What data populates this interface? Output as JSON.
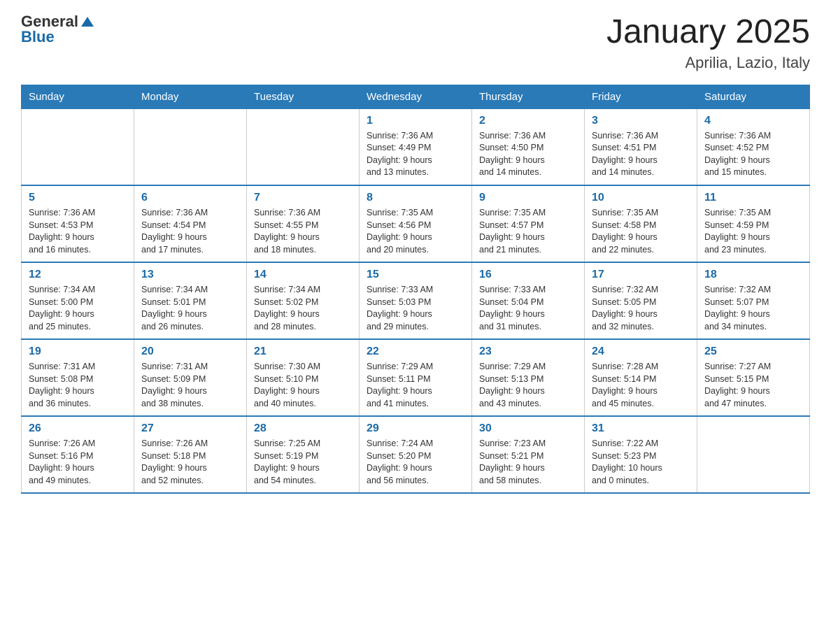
{
  "logo": {
    "text_general": "General",
    "text_blue": "Blue",
    "arrow": "▲"
  },
  "title": "January 2025",
  "subtitle": "Aprilia, Lazio, Italy",
  "weekdays": [
    "Sunday",
    "Monday",
    "Tuesday",
    "Wednesday",
    "Thursday",
    "Friday",
    "Saturday"
  ],
  "weeks": [
    [
      {
        "day": "",
        "info": ""
      },
      {
        "day": "",
        "info": ""
      },
      {
        "day": "",
        "info": ""
      },
      {
        "day": "1",
        "info": "Sunrise: 7:36 AM\nSunset: 4:49 PM\nDaylight: 9 hours\nand 13 minutes."
      },
      {
        "day": "2",
        "info": "Sunrise: 7:36 AM\nSunset: 4:50 PM\nDaylight: 9 hours\nand 14 minutes."
      },
      {
        "day": "3",
        "info": "Sunrise: 7:36 AM\nSunset: 4:51 PM\nDaylight: 9 hours\nand 14 minutes."
      },
      {
        "day": "4",
        "info": "Sunrise: 7:36 AM\nSunset: 4:52 PM\nDaylight: 9 hours\nand 15 minutes."
      }
    ],
    [
      {
        "day": "5",
        "info": "Sunrise: 7:36 AM\nSunset: 4:53 PM\nDaylight: 9 hours\nand 16 minutes."
      },
      {
        "day": "6",
        "info": "Sunrise: 7:36 AM\nSunset: 4:54 PM\nDaylight: 9 hours\nand 17 minutes."
      },
      {
        "day": "7",
        "info": "Sunrise: 7:36 AM\nSunset: 4:55 PM\nDaylight: 9 hours\nand 18 minutes."
      },
      {
        "day": "8",
        "info": "Sunrise: 7:35 AM\nSunset: 4:56 PM\nDaylight: 9 hours\nand 20 minutes."
      },
      {
        "day": "9",
        "info": "Sunrise: 7:35 AM\nSunset: 4:57 PM\nDaylight: 9 hours\nand 21 minutes."
      },
      {
        "day": "10",
        "info": "Sunrise: 7:35 AM\nSunset: 4:58 PM\nDaylight: 9 hours\nand 22 minutes."
      },
      {
        "day": "11",
        "info": "Sunrise: 7:35 AM\nSunset: 4:59 PM\nDaylight: 9 hours\nand 23 minutes."
      }
    ],
    [
      {
        "day": "12",
        "info": "Sunrise: 7:34 AM\nSunset: 5:00 PM\nDaylight: 9 hours\nand 25 minutes."
      },
      {
        "day": "13",
        "info": "Sunrise: 7:34 AM\nSunset: 5:01 PM\nDaylight: 9 hours\nand 26 minutes."
      },
      {
        "day": "14",
        "info": "Sunrise: 7:34 AM\nSunset: 5:02 PM\nDaylight: 9 hours\nand 28 minutes."
      },
      {
        "day": "15",
        "info": "Sunrise: 7:33 AM\nSunset: 5:03 PM\nDaylight: 9 hours\nand 29 minutes."
      },
      {
        "day": "16",
        "info": "Sunrise: 7:33 AM\nSunset: 5:04 PM\nDaylight: 9 hours\nand 31 minutes."
      },
      {
        "day": "17",
        "info": "Sunrise: 7:32 AM\nSunset: 5:05 PM\nDaylight: 9 hours\nand 32 minutes."
      },
      {
        "day": "18",
        "info": "Sunrise: 7:32 AM\nSunset: 5:07 PM\nDaylight: 9 hours\nand 34 minutes."
      }
    ],
    [
      {
        "day": "19",
        "info": "Sunrise: 7:31 AM\nSunset: 5:08 PM\nDaylight: 9 hours\nand 36 minutes."
      },
      {
        "day": "20",
        "info": "Sunrise: 7:31 AM\nSunset: 5:09 PM\nDaylight: 9 hours\nand 38 minutes."
      },
      {
        "day": "21",
        "info": "Sunrise: 7:30 AM\nSunset: 5:10 PM\nDaylight: 9 hours\nand 40 minutes."
      },
      {
        "day": "22",
        "info": "Sunrise: 7:29 AM\nSunset: 5:11 PM\nDaylight: 9 hours\nand 41 minutes."
      },
      {
        "day": "23",
        "info": "Sunrise: 7:29 AM\nSunset: 5:13 PM\nDaylight: 9 hours\nand 43 minutes."
      },
      {
        "day": "24",
        "info": "Sunrise: 7:28 AM\nSunset: 5:14 PM\nDaylight: 9 hours\nand 45 minutes."
      },
      {
        "day": "25",
        "info": "Sunrise: 7:27 AM\nSunset: 5:15 PM\nDaylight: 9 hours\nand 47 minutes."
      }
    ],
    [
      {
        "day": "26",
        "info": "Sunrise: 7:26 AM\nSunset: 5:16 PM\nDaylight: 9 hours\nand 49 minutes."
      },
      {
        "day": "27",
        "info": "Sunrise: 7:26 AM\nSunset: 5:18 PM\nDaylight: 9 hours\nand 52 minutes."
      },
      {
        "day": "28",
        "info": "Sunrise: 7:25 AM\nSunset: 5:19 PM\nDaylight: 9 hours\nand 54 minutes."
      },
      {
        "day": "29",
        "info": "Sunrise: 7:24 AM\nSunset: 5:20 PM\nDaylight: 9 hours\nand 56 minutes."
      },
      {
        "day": "30",
        "info": "Sunrise: 7:23 AM\nSunset: 5:21 PM\nDaylight: 9 hours\nand 58 minutes."
      },
      {
        "day": "31",
        "info": "Sunrise: 7:22 AM\nSunset: 5:23 PM\nDaylight: 10 hours\nand 0 minutes."
      },
      {
        "day": "",
        "info": ""
      }
    ]
  ]
}
